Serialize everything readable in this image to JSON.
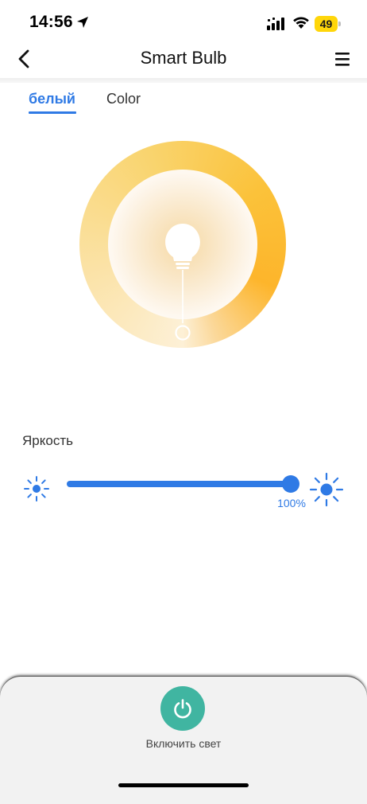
{
  "status_bar": {
    "time": "14:56",
    "battery": "49",
    "battery_color": "#ffd60a"
  },
  "nav": {
    "title": "Smart Bulb",
    "back_icon": "chevron-left-icon",
    "menu_icon": "hamburger-menu-icon"
  },
  "tabs": [
    {
      "label": "белый",
      "active": true
    },
    {
      "label": "Color",
      "active": false
    }
  ],
  "color_wheel": {
    "mode": "white-temperature",
    "ring_colors": [
      "#fdf0d6",
      "#f9d46e",
      "#fdb52b"
    ]
  },
  "brightness": {
    "label": "Яркость",
    "value": 100,
    "value_label": "100%",
    "min_icon": "sun-small-icon",
    "max_icon": "sun-large-icon"
  },
  "power": {
    "label": "Включить свет",
    "icon": "power-icon",
    "color": "#40b5a1"
  },
  "colors": {
    "accent": "#2f7ae5"
  }
}
